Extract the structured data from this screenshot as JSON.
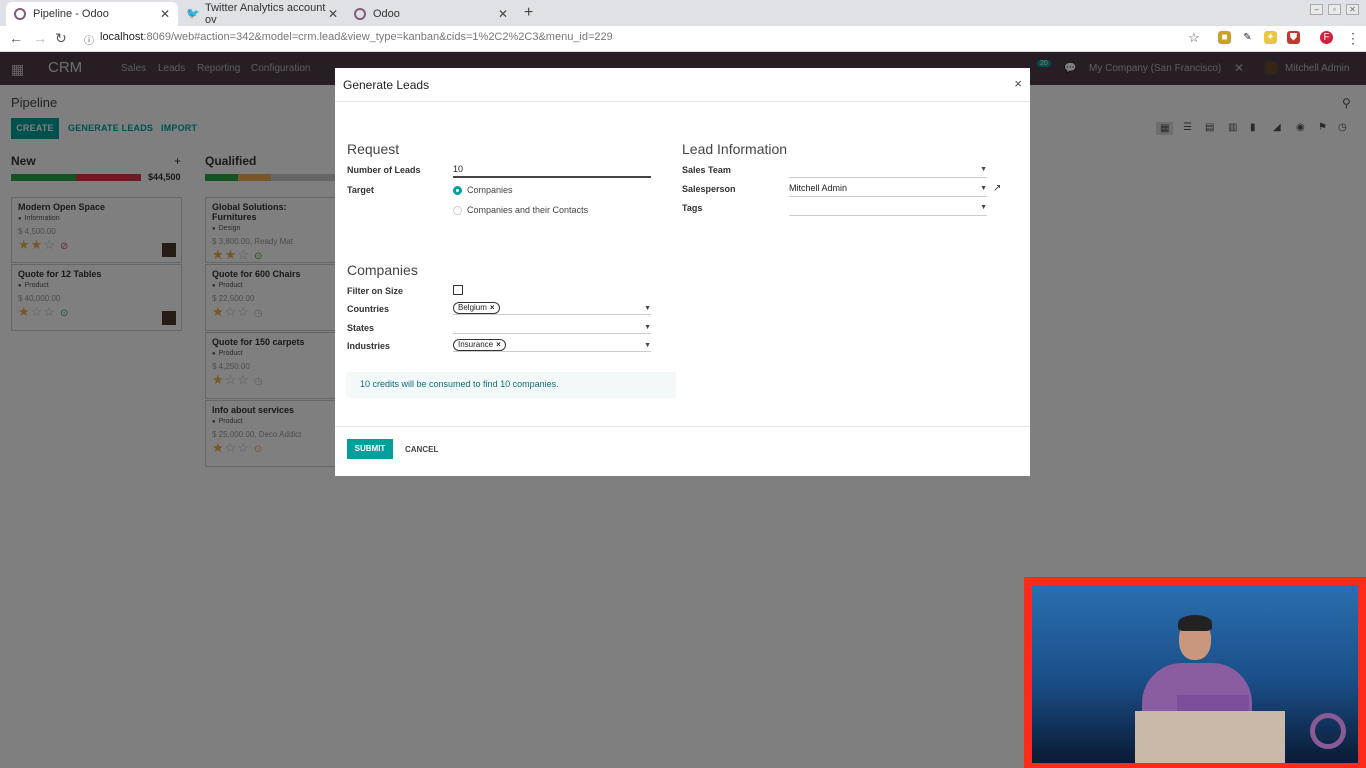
{
  "browser": {
    "tabs": [
      {
        "title": "Pipeline - Odoo",
        "icon": "odoo-icon",
        "active": true
      },
      {
        "title": "Twitter Analytics account ov",
        "icon": "twitter-icon",
        "active": false
      },
      {
        "title": "Odoo",
        "icon": "odoo-icon",
        "active": false
      }
    ],
    "url_host": "localhost",
    "url_rest": ":8069/web#action=342&model=crm.lead&view_type=kanban&cids=1%2C2%2C3&menu_id=229"
  },
  "odoo_nav": {
    "brand": "CRM",
    "menus": [
      "Sales",
      "Leads",
      "Reporting",
      "Configuration"
    ],
    "company": "My Company (San Francisco)",
    "user": "Mitchell Admin",
    "badge": "20"
  },
  "control_panel": {
    "breadcrumb": "Pipeline",
    "create": "CREATE",
    "generate_leads": "GENERATE LEADS",
    "import": "IMPORT"
  },
  "kanban": {
    "columns": [
      {
        "title": "New",
        "total": "$44,500",
        "cards": [
          {
            "title": "Modern Open Space",
            "tag": "Information",
            "amount": "$ 4,500.00",
            "stars": 2
          },
          {
            "title": "Quote for 12 Tables",
            "tag": "Product",
            "amount": "$ 40,000.00",
            "stars": 1
          }
        ]
      },
      {
        "title": "Qualified",
        "cards": [
          {
            "title": "Global Solutions: Furnitures",
            "tag": "Design",
            "amount": "$ 3,800.00, Ready Mat",
            "stars": 2
          },
          {
            "title": "Quote for 600 Chairs",
            "tag": "Product",
            "amount": "$ 22,500.00",
            "stars": 1
          },
          {
            "title": "Quote for 150 carpets",
            "tag": "Product",
            "amount": "$ 4,250.00",
            "stars": 1
          },
          {
            "title": "Info about services",
            "tag": "Product",
            "amount": "$ 25,000.00, Deco Addict",
            "stars": 1
          }
        ]
      }
    ]
  },
  "modal": {
    "title": "Generate Leads",
    "request": {
      "heading": "Request",
      "num_leads_label": "Number of Leads",
      "num_leads_value": "10",
      "target_label": "Target",
      "target_options": [
        "Companies",
        "Companies and their Contacts"
      ],
      "target_selected": "Companies"
    },
    "lead_info": {
      "heading": "Lead Information",
      "sales_team_label": "Sales Team",
      "sales_team_value": "",
      "salesperson_label": "Salesperson",
      "salesperson_value": "Mitchell Admin",
      "tags_label": "Tags",
      "tags_value": ""
    },
    "companies": {
      "heading": "Companies",
      "filter_size_label": "Filter on Size",
      "filter_size_checked": false,
      "countries_label": "Countries",
      "countries_tag": "Belgium",
      "states_label": "States",
      "industries_label": "Industries",
      "industries_tag": "Insurance"
    },
    "info_text": "10 credits will be consumed to find 10 companies.",
    "submit": "SUBMIT",
    "cancel": "CANCEL"
  },
  "colors": {
    "primary": "#00a09d",
    "navbar": "#4e3d4a",
    "webcam_border": "#ff2a1a"
  }
}
